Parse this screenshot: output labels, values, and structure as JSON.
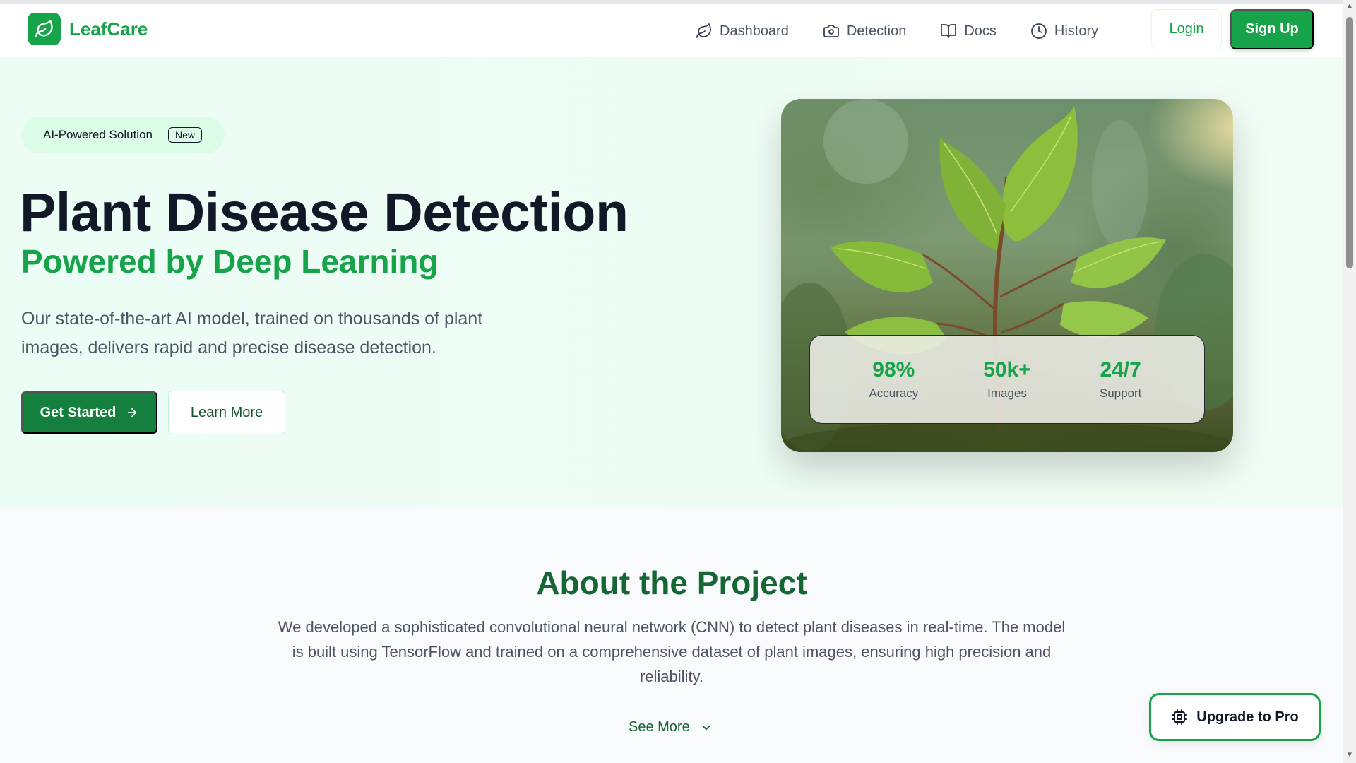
{
  "brand": {
    "name": "LeafCare"
  },
  "nav": {
    "links": [
      {
        "label": "Dashboard",
        "icon": "leaf-icon"
      },
      {
        "label": "Detection",
        "icon": "camera-icon"
      },
      {
        "label": "Docs",
        "icon": "book-icon"
      },
      {
        "label": "History",
        "icon": "clock-icon"
      }
    ],
    "login_label": "Login",
    "signup_label": "Sign Up"
  },
  "hero": {
    "badge_text": "AI-Powered Solution",
    "badge_new": "New",
    "title": "Plant Disease Detection",
    "subtitle": "Powered by Deep Learning",
    "description": "Our state-of-the-art AI model, trained on thousands of plant images, delivers rapid and precise disease detection.",
    "get_started_label": "Get Started",
    "learn_more_label": "Learn More",
    "stats": [
      {
        "value": "98%",
        "label": "Accuracy"
      },
      {
        "value": "50k+",
        "label": "Images"
      },
      {
        "value": "24/7",
        "label": "Support"
      }
    ]
  },
  "about": {
    "title": "About the Project",
    "description": "We developed a sophisticated convolutional neural network (CNN) to detect plant diseases in real-time. The model is built using TensorFlow and trained on a comprehensive dataset of plant images, ensuring high precision and reliability.",
    "see_more_label": "See More"
  },
  "upgrade": {
    "label": "Upgrade to Pro"
  },
  "colors": {
    "primary": "#16a34a",
    "dark_green": "#166534",
    "hero_bg": "#ecfdf5",
    "text_dark": "#111827"
  }
}
